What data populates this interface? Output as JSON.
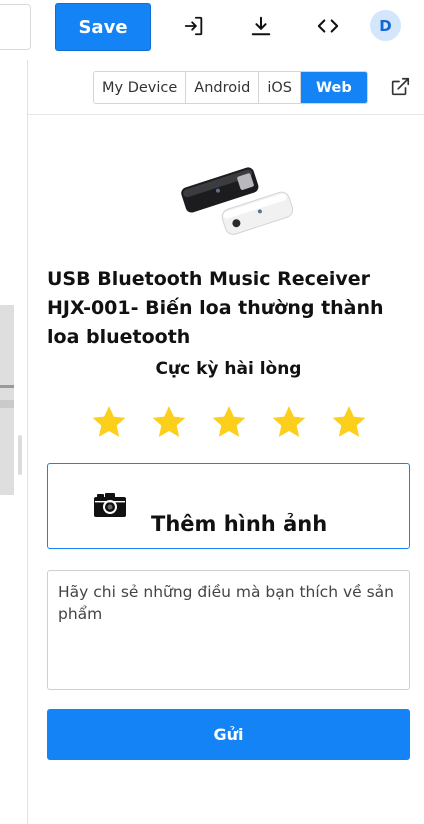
{
  "toolbar": {
    "save_label": "Save",
    "icons": [
      "login-icon",
      "download-icon",
      "code-icon"
    ],
    "avatar_initial": "D",
    "accent_color": "#1383f5"
  },
  "device_tabs": {
    "items": [
      "My Device",
      "Android",
      "iOS",
      "Web"
    ],
    "active": "Web"
  },
  "product": {
    "title": "USB Bluetooth Music Receiver HJX-001- Biến loa thường thành loa bluetooth"
  },
  "rating": {
    "label": "Cực kỳ hài lòng",
    "stars_filled": 5,
    "stars_total": 5,
    "star_color": "#fccf1d"
  },
  "add_photo": {
    "label": "Thêm hình ảnh"
  },
  "review": {
    "placeholder": "Hãy chi sẻ những điều mà bạn thích về sản phẩm"
  },
  "submit": {
    "label": "Gửi"
  }
}
